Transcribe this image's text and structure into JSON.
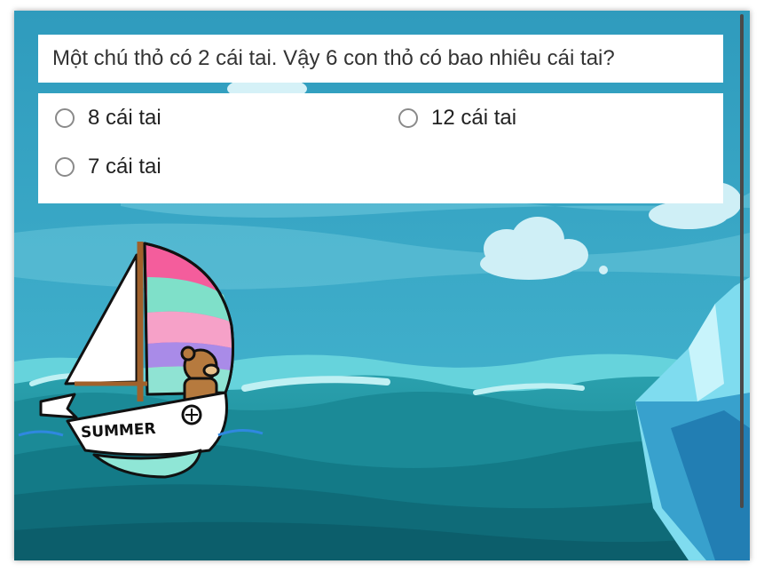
{
  "quiz": {
    "question": "Một chú thỏ có 2 cái tai. Vậy 6 con thỏ có bao nhiêu cái tai?",
    "options": [
      {
        "label": "8 cái tai"
      },
      {
        "label": "12 cái tai"
      },
      {
        "label": "7 cái tai"
      }
    ]
  },
  "scene": {
    "boat_text": "SUMMER",
    "colors": {
      "sky": "#3aa8c8",
      "sea_light": "#5fcfd8",
      "sea_mid": "#1f8e9c",
      "sea_dark": "#0f6f7c",
      "sail_pink": "#f45d9c",
      "sail_green": "#7fe0c9",
      "sail_purple": "#a98be8",
      "iceberg": "#8fe3f4"
    }
  }
}
